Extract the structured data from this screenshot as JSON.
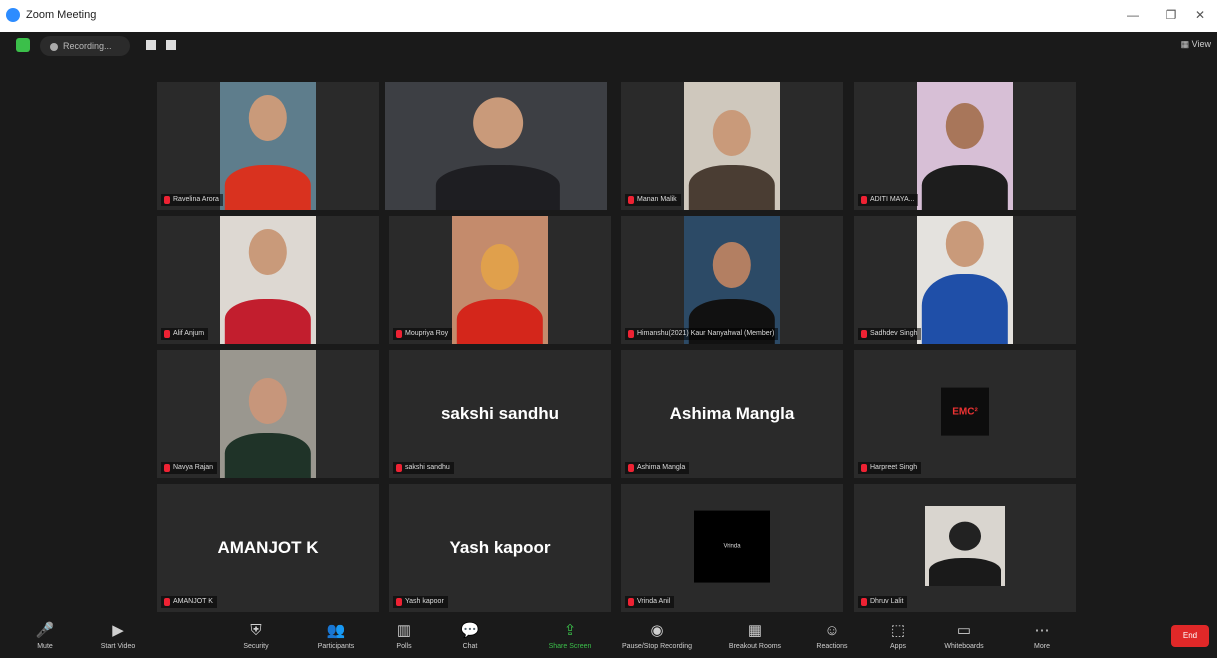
{
  "window": {
    "title": "Zoom Meeting",
    "minimize": "—",
    "maximize": "❐",
    "close": "✕"
  },
  "topbar": {
    "recording_label": "Recording...",
    "view_label": "View"
  },
  "tiles": [
    {
      "name": "Ravelina Arora",
      "type": "video"
    },
    {
      "name": "",
      "type": "video-wide",
      "active": true
    },
    {
      "name": "Manan Malik",
      "type": "video"
    },
    {
      "name": "ADITI MAYA...",
      "type": "video"
    },
    {
      "name": "Alif Anjum",
      "type": "video"
    },
    {
      "name": "Moupriya Roy",
      "type": "video"
    },
    {
      "name": "Himanshu(2021) Kaur Nanyahwal (Member)",
      "type": "video"
    },
    {
      "name": "Sadhdev Singh",
      "type": "video"
    },
    {
      "name": "Navya Rajan",
      "type": "video"
    },
    {
      "name": "sakshi sandhu",
      "type": "name",
      "big": "sakshi sandhu"
    },
    {
      "name": "Ashima Mangla",
      "type": "name",
      "big": "Ashima Mangla"
    },
    {
      "name": "Harpreet Singh",
      "type": "logo",
      "logo_text": "EMC²"
    },
    {
      "name": "AMANJOT K",
      "type": "name",
      "big": "AMANJOT K"
    },
    {
      "name": "Yash kapoor",
      "type": "name",
      "big": "Yash kapoor"
    },
    {
      "name": "Vrinda Anil",
      "type": "black",
      "inner_text": "Vrinda"
    },
    {
      "name": "Dhruv Lalit",
      "type": "video"
    }
  ],
  "toolbar": {
    "items": [
      {
        "icon": "🎤",
        "label": "Mute"
      },
      {
        "icon": "▶",
        "label": "Start Video"
      },
      {
        "icon": "⛨",
        "label": "Security"
      },
      {
        "icon": "👥",
        "label": "Participants"
      },
      {
        "icon": "▥",
        "label": "Polls"
      },
      {
        "icon": "💬",
        "label": "Chat"
      },
      {
        "icon": "⇪",
        "label": "Share Screen"
      },
      {
        "icon": "◉",
        "label": "Pause/Stop Recording"
      },
      {
        "icon": "▦",
        "label": "Breakout Rooms"
      },
      {
        "icon": "☺",
        "label": "Reactions"
      },
      {
        "icon": "⬚",
        "label": "Apps"
      },
      {
        "icon": "▭",
        "label": "Whiteboards"
      },
      {
        "icon": "⋯",
        "label": "More"
      }
    ],
    "end_label": "End"
  },
  "colors": {
    "active_speaker": "#b7d83d",
    "share_green": "#3bbf4a",
    "end_red": "#e02828"
  }
}
